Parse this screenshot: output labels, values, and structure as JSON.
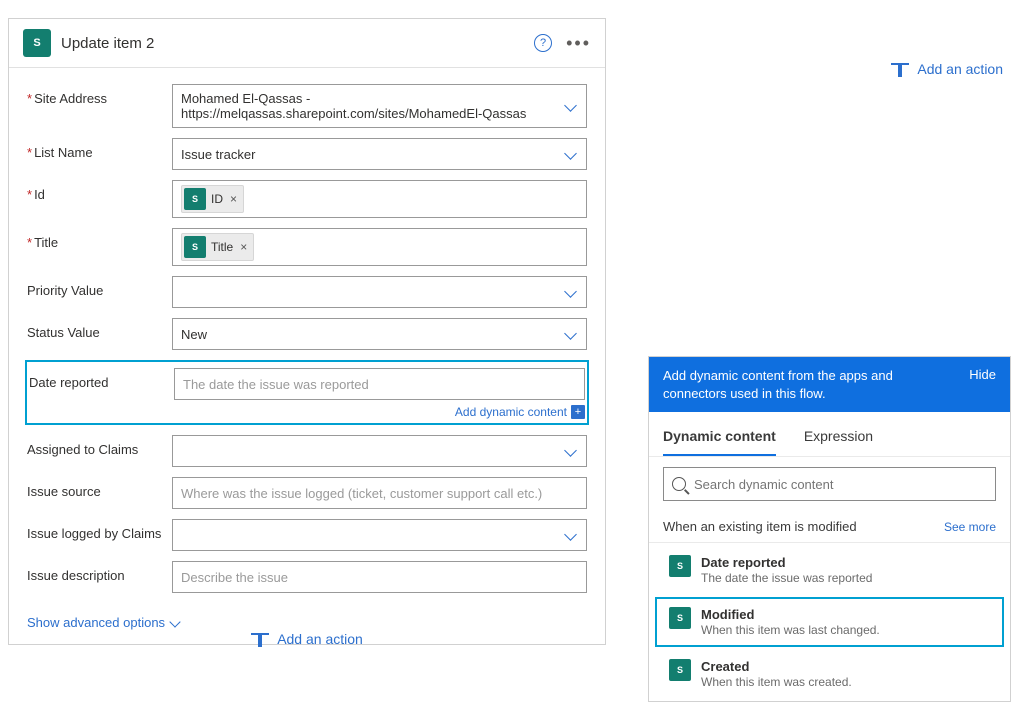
{
  "header": {
    "title": "Update item 2",
    "badge": "S"
  },
  "fields": {
    "site_address": {
      "label": "Site Address",
      "line1": "Mohamed El-Qassas -",
      "line2": "https://melqassas.sharepoint.com/sites/MohamedEl-Qassas"
    },
    "list_name": {
      "label": "List Name",
      "value": "Issue tracker"
    },
    "id": {
      "label": "Id",
      "token": "ID"
    },
    "title": {
      "label": "Title",
      "token": "Title"
    },
    "priority": {
      "label": "Priority Value",
      "value": ""
    },
    "status": {
      "label": "Status Value",
      "value": "New"
    },
    "date_reported": {
      "label": "Date reported",
      "placeholder": "The date the issue was reported"
    },
    "add_dynamic": "Add dynamic content",
    "assigned_to": {
      "label": "Assigned to Claims"
    },
    "issue_source": {
      "label": "Issue source",
      "placeholder": "Where was the issue logged (ticket, customer support call etc.)"
    },
    "issue_logged_by": {
      "label": "Issue logged by Claims"
    },
    "issue_description": {
      "label": "Issue description",
      "placeholder": "Describe the issue"
    }
  },
  "advanced_link": "Show advanced options",
  "add_action_label": "Add an action",
  "dynamic_panel": {
    "banner": "Add dynamic content from the apps and connectors used in this flow.",
    "hide": "Hide",
    "tabs": {
      "dynamic": "Dynamic content",
      "expression": "Expression"
    },
    "search_placeholder": "Search dynamic content",
    "section_title": "When an existing item is modified",
    "see_more": "See more",
    "items": [
      {
        "title": "Date reported",
        "sub": "The date the issue was reported"
      },
      {
        "title": "Modified",
        "sub": "When this item was last changed."
      },
      {
        "title": "Created",
        "sub": "When this item was created."
      }
    ]
  }
}
